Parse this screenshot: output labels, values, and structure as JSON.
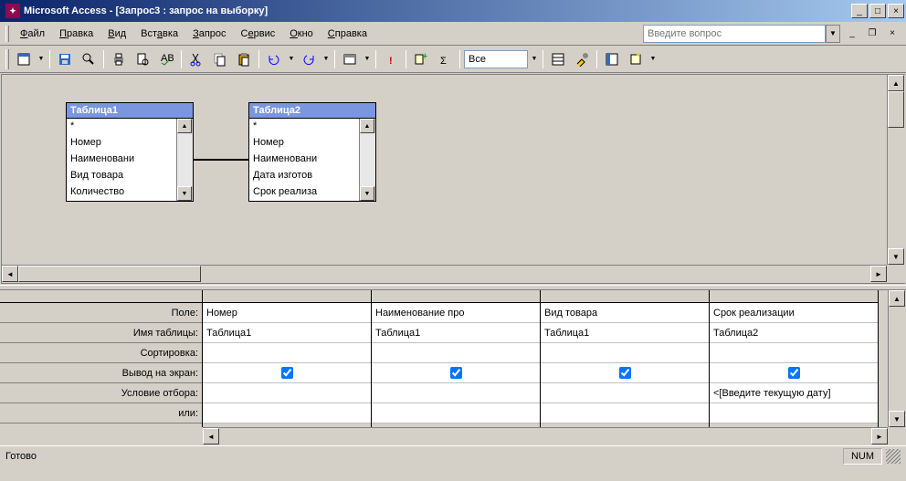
{
  "title": "Microsoft Access - [Запрос3 : запрос на выборку]",
  "menu": [
    "Файл",
    "Правка",
    "Вид",
    "Вставка",
    "Запрос",
    "Сервис",
    "Окно",
    "Справка"
  ],
  "menu_accel": [
    0,
    0,
    0,
    1,
    0,
    0,
    0,
    0
  ],
  "help_placeholder": "Введите вопрос",
  "toolbar_combo": "Все",
  "tables": [
    {
      "title": "Таблица1",
      "fields": [
        "*",
        "Номер",
        "Наименовани",
        "Вид товара",
        "Количество"
      ]
    },
    {
      "title": "Таблица2",
      "fields": [
        "*",
        "Номер",
        "Наименовани",
        "Дата изготов",
        "Срок реализа"
      ]
    }
  ],
  "grid_labels": [
    "Поле:",
    "Имя таблицы:",
    "Сортировка:",
    "Вывод на экран:",
    "Условие отбора:",
    "или:"
  ],
  "grid_cols": [
    {
      "field": "Номер",
      "table": "Таблица1",
      "sort": "",
      "show": true,
      "criteria": "",
      "or": ""
    },
    {
      "field": "Наименование про",
      "table": "Таблица1",
      "sort": "",
      "show": true,
      "criteria": "",
      "or": ""
    },
    {
      "field": "Вид товара",
      "table": "Таблица1",
      "sort": "",
      "show": true,
      "criteria": "",
      "or": ""
    },
    {
      "field": "Срок реализации",
      "table": "Таблица2",
      "sort": "",
      "show": true,
      "criteria": "<[Введите текущую дату]",
      "or": ""
    }
  ],
  "status": "Готово",
  "num": "NUM"
}
